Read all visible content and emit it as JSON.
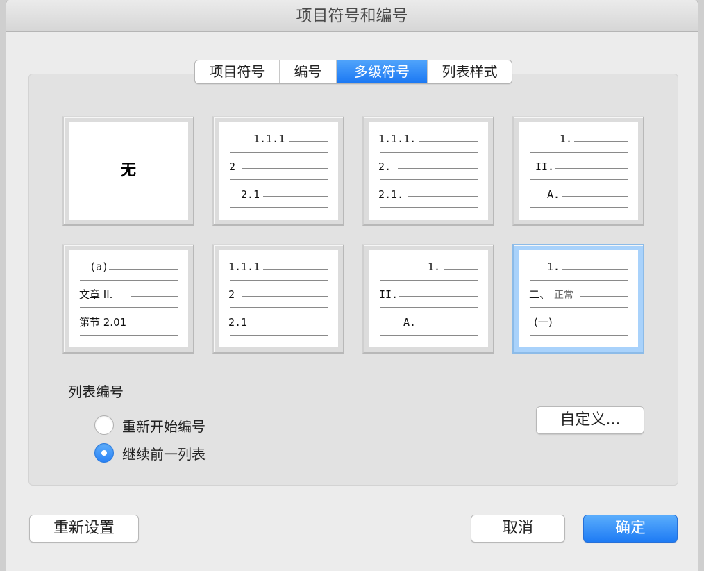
{
  "window": {
    "title": "项目符号和编号"
  },
  "tabs": [
    {
      "label": "项目符号",
      "active": false
    },
    {
      "label": "编号",
      "active": false
    },
    {
      "label": "多级符号",
      "active": true
    },
    {
      "label": "列表样式",
      "active": false
    }
  ],
  "gallery": {
    "none_label": "无",
    "cell2": [
      "1.1.1",
      "2",
      "2.1"
    ],
    "cell3": [
      "1.1.1.",
      "2.",
      "2.1."
    ],
    "cell4": [
      "1.",
      "II.",
      "A."
    ],
    "cell5": [
      "(a)",
      "文章 II.",
      "第节 2.01"
    ],
    "cell6": [
      "1.1.1",
      "2",
      "2.1"
    ],
    "cell7": [
      "1.",
      "II.",
      "A."
    ],
    "cell8": [
      "1.",
      "二、",
      "正常",
      "(一)"
    ]
  },
  "list_numbering": {
    "label": "列表编号",
    "restart_label": "重新开始编号",
    "continue_label": "继续前一列表",
    "selected": "continue"
  },
  "buttons": {
    "customize": "自定义...",
    "reset": "重新设置",
    "cancel": "取消",
    "ok": "确定"
  },
  "colors": {
    "accent": "#1e7bf4",
    "selection": "#a9d2fb"
  }
}
